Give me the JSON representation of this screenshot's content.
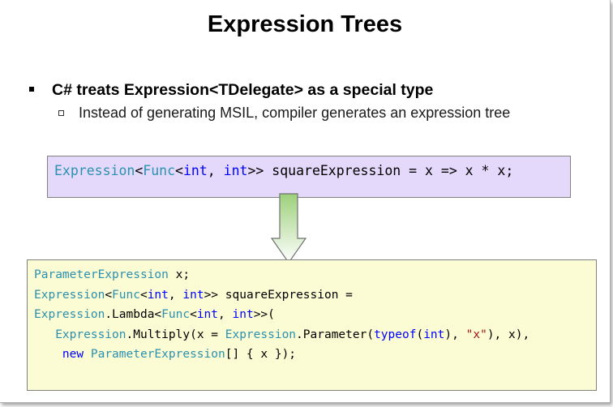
{
  "slide": {
    "title": "Expression Trees",
    "bullet_main": "C# treats Expression<TDelegate> as a special type",
    "bullet_sub": "Instead of generating MSIL, compiler generates an expression tree",
    "colors": {
      "code_top_bg": "#e4d9fb",
      "code_bottom_bg": "#fbfbd4",
      "type_color": "#2b91af",
      "keyword_color": "#0000ff",
      "string_color": "#a31515",
      "arrow_top": "#9cd07a",
      "arrow_bottom": "#ffffff"
    },
    "code_top": [
      {
        "kind": "t",
        "text": "Expression"
      },
      {
        "kind": "p",
        "text": "<"
      },
      {
        "kind": "t",
        "text": "Func"
      },
      {
        "kind": "p",
        "text": "<"
      },
      {
        "kind": "k",
        "text": "int"
      },
      {
        "kind": "p",
        "text": ", "
      },
      {
        "kind": "k",
        "text": "int"
      },
      {
        "kind": "p",
        "text": ">> squareExpression = x => x * x;"
      }
    ],
    "code_bottom": [
      [
        {
          "kind": "t",
          "text": "ParameterExpression"
        },
        {
          "kind": "p",
          "text": " x;"
        }
      ],
      [
        {
          "kind": "t",
          "text": "Expression"
        },
        {
          "kind": "p",
          "text": "<"
        },
        {
          "kind": "t",
          "text": "Func"
        },
        {
          "kind": "p",
          "text": "<"
        },
        {
          "kind": "k",
          "text": "int"
        },
        {
          "kind": "p",
          "text": ", "
        },
        {
          "kind": "k",
          "text": "int"
        },
        {
          "kind": "p",
          "text": ">> squareExpression ="
        }
      ],
      [
        {
          "kind": "t",
          "text": "Expression"
        },
        {
          "kind": "p",
          "text": ".Lambda<"
        },
        {
          "kind": "t",
          "text": "Func"
        },
        {
          "kind": "p",
          "text": "<"
        },
        {
          "kind": "k",
          "text": "int"
        },
        {
          "kind": "p",
          "text": ", "
        },
        {
          "kind": "k",
          "text": "int"
        },
        {
          "kind": "p",
          "text": ">>("
        }
      ],
      [
        {
          "kind": "p",
          "text": "   "
        },
        {
          "kind": "t",
          "text": "Expression"
        },
        {
          "kind": "p",
          "text": ".Multiply(x = "
        },
        {
          "kind": "t",
          "text": "Expression"
        },
        {
          "kind": "p",
          "text": ".Parameter("
        },
        {
          "kind": "k",
          "text": "typeof"
        },
        {
          "kind": "p",
          "text": "("
        },
        {
          "kind": "k",
          "text": "int"
        },
        {
          "kind": "p",
          "text": "), "
        },
        {
          "kind": "s",
          "text": "\"x\""
        },
        {
          "kind": "p",
          "text": "), x),"
        }
      ],
      [
        {
          "kind": "p",
          "text": "    "
        },
        {
          "kind": "k",
          "text": "new"
        },
        {
          "kind": "p",
          "text": " "
        },
        {
          "kind": "t",
          "text": "ParameterExpression"
        },
        {
          "kind": "p",
          "text": "[] { x });"
        }
      ]
    ]
  }
}
